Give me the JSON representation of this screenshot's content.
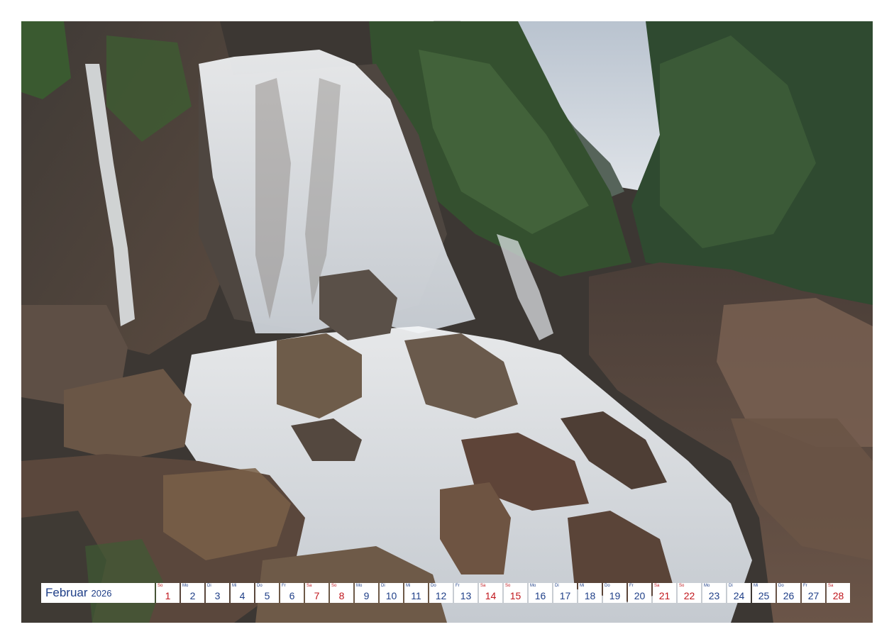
{
  "calendar": {
    "month": "Februar",
    "year": "2026",
    "days": [
      {
        "num": "1",
        "wd": "So",
        "weekend": true
      },
      {
        "num": "2",
        "wd": "Mo",
        "weekend": false
      },
      {
        "num": "3",
        "wd": "Di",
        "weekend": false
      },
      {
        "num": "4",
        "wd": "Mi",
        "weekend": false
      },
      {
        "num": "5",
        "wd": "Do",
        "weekend": false
      },
      {
        "num": "6",
        "wd": "Fr",
        "weekend": false
      },
      {
        "num": "7",
        "wd": "Sa",
        "weekend": true
      },
      {
        "num": "8",
        "wd": "So",
        "weekend": true
      },
      {
        "num": "9",
        "wd": "Mo",
        "weekend": false
      },
      {
        "num": "10",
        "wd": "Di",
        "weekend": false
      },
      {
        "num": "11",
        "wd": "Mi",
        "weekend": false
      },
      {
        "num": "12",
        "wd": "Do",
        "weekend": false
      },
      {
        "num": "13",
        "wd": "Fr",
        "weekend": false
      },
      {
        "num": "14",
        "wd": "Sa",
        "weekend": true
      },
      {
        "num": "15",
        "wd": "So",
        "weekend": true
      },
      {
        "num": "16",
        "wd": "Mo",
        "weekend": false
      },
      {
        "num": "17",
        "wd": "Di",
        "weekend": false
      },
      {
        "num": "18",
        "wd": "Mi",
        "weekend": false
      },
      {
        "num": "19",
        "wd": "Do",
        "weekend": false
      },
      {
        "num": "20",
        "wd": "Fr",
        "weekend": false
      },
      {
        "num": "21",
        "wd": "Sa",
        "weekend": true
      },
      {
        "num": "22",
        "wd": "So",
        "weekend": true
      },
      {
        "num": "23",
        "wd": "Mo",
        "weekend": false
      },
      {
        "num": "24",
        "wd": "Di",
        "weekend": false
      },
      {
        "num": "25",
        "wd": "Mi",
        "weekend": false
      },
      {
        "num": "26",
        "wd": "Do",
        "weekend": false
      },
      {
        "num": "27",
        "wd": "Fr",
        "weekend": false
      },
      {
        "num": "28",
        "wd": "Sa",
        "weekend": true
      }
    ]
  },
  "colors": {
    "weekday": "#1f3f88",
    "weekend": "#c0161c"
  },
  "icons": {
    "binding": "spiral-binding-holes"
  }
}
